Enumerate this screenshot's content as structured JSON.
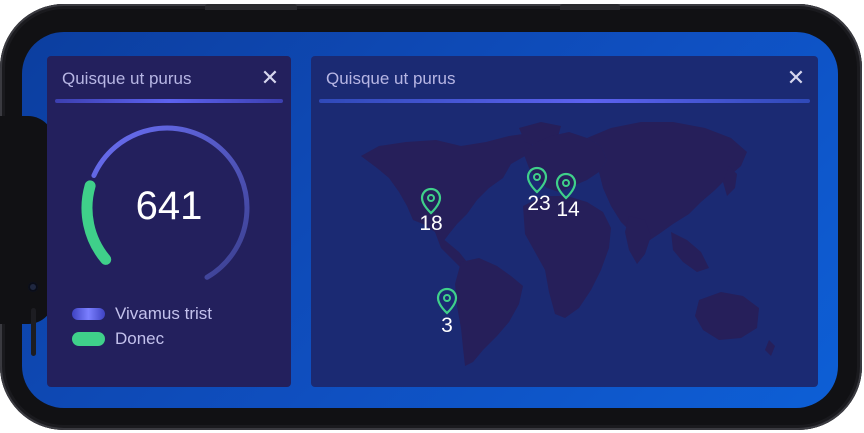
{
  "gauge_card": {
    "title": "Quisque ut purus",
    "close_icon": "close-icon",
    "value": "641",
    "progress_fraction": 0.2,
    "legend": [
      {
        "label": "Vivamus trist",
        "color": "#5b5ff0"
      },
      {
        "label": "Donec",
        "color": "#3fd08a"
      }
    ]
  },
  "map_card": {
    "title": "Quisque ut purus",
    "close_icon": "close-icon",
    "markers": [
      {
        "label": "18",
        "icon": "map-pin-icon"
      },
      {
        "label": "23",
        "icon": "map-pin-icon"
      },
      {
        "label": "14",
        "icon": "map-pin-icon"
      },
      {
        "label": "3",
        "icon": "map-pin-icon"
      }
    ]
  },
  "colors": {
    "accent_green": "#3fd08a",
    "accent_purple": "#5b5ff0",
    "card_bg": "#23205d",
    "map_land": "#261f5a"
  }
}
